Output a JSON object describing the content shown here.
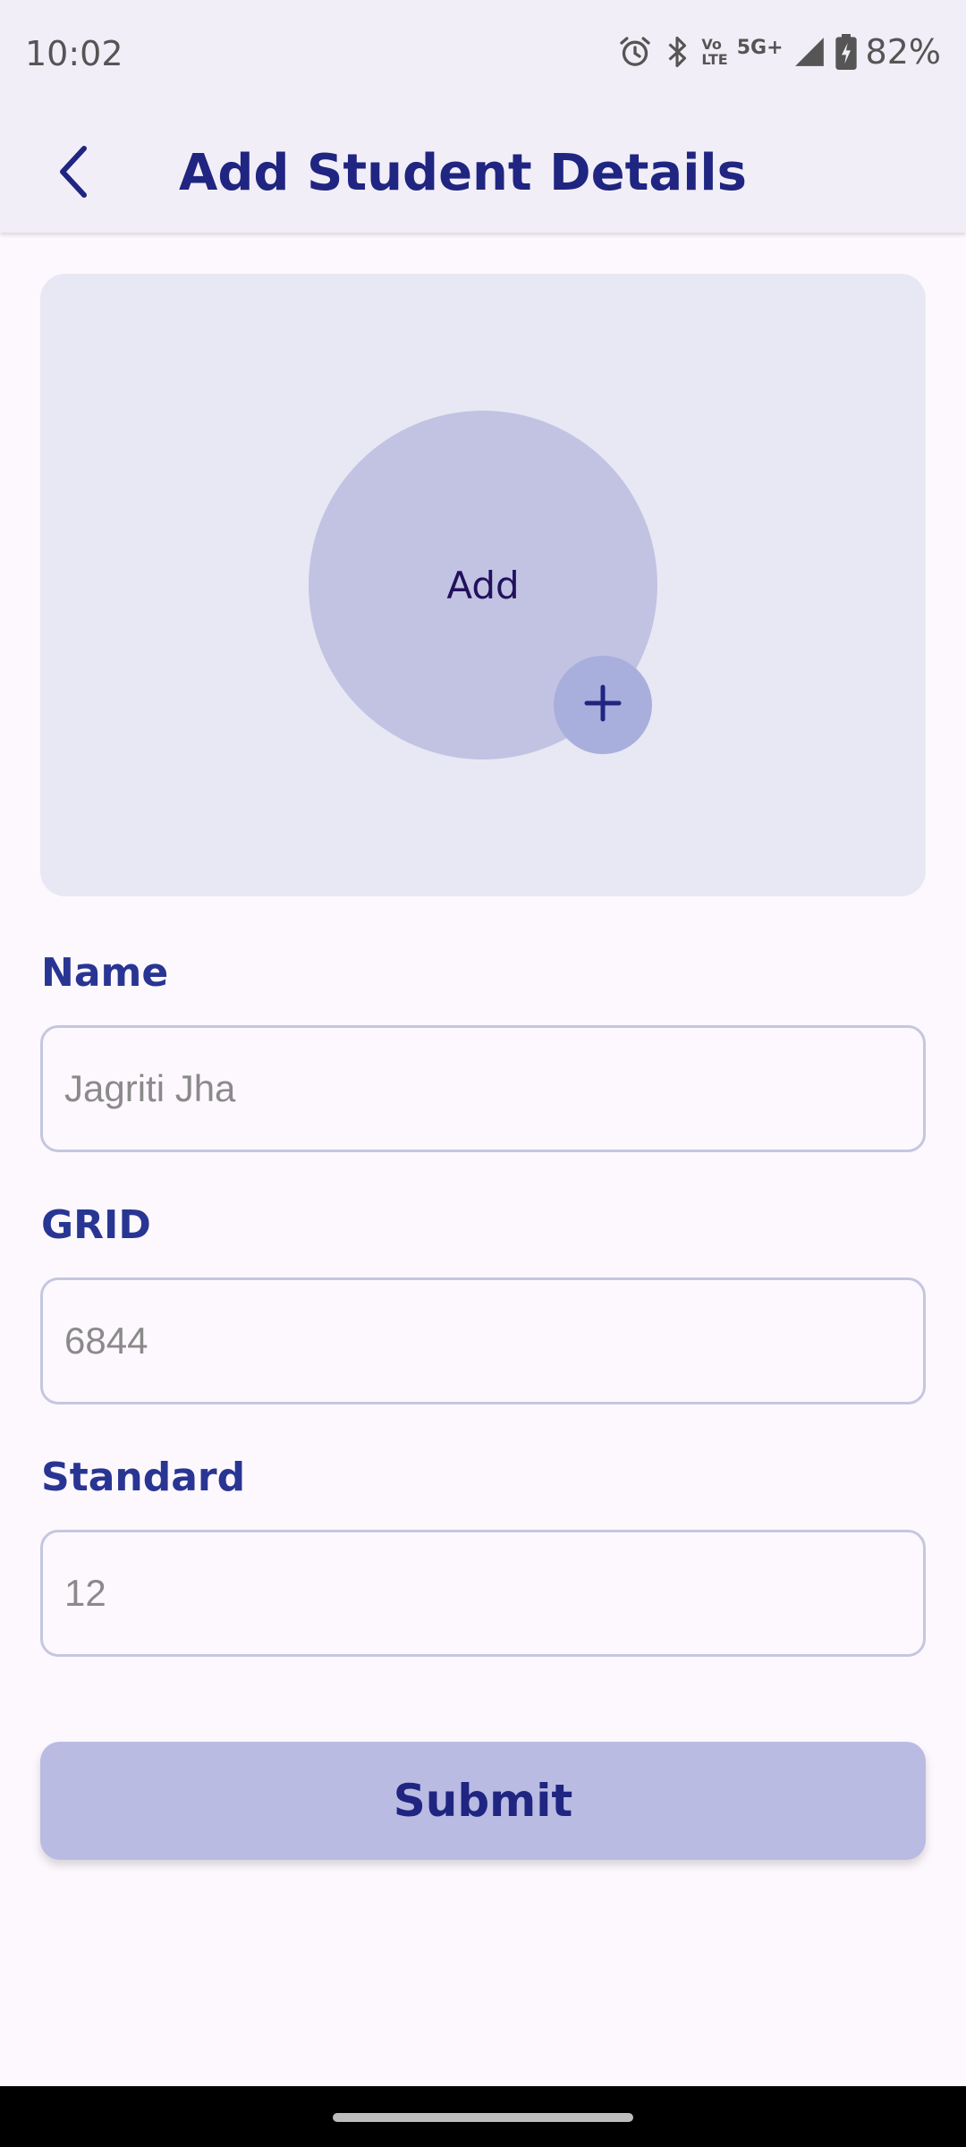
{
  "status_bar": {
    "time": "10:02",
    "volte_top": "Vo",
    "volte_bottom": "LTE",
    "network": "5G+",
    "battery": "82%",
    "icons": [
      "alarm-icon",
      "bluetooth-icon",
      "volte-icon",
      "signal-icon",
      "battery-charging-icon"
    ]
  },
  "app_bar": {
    "title": "Add Student Details",
    "back_icon": "chevron-left-icon"
  },
  "photo": {
    "label": "Add",
    "add_icon": "plus-icon"
  },
  "form": {
    "name": {
      "label": "Name",
      "placeholder": "Jagriti Jha",
      "value": ""
    },
    "grid": {
      "label": "GRID",
      "placeholder": "6844",
      "value": ""
    },
    "standard": {
      "label": "Standard",
      "placeholder": "12",
      "value": ""
    }
  },
  "submit_label": "Submit",
  "colors": {
    "primary": "#1f2580",
    "label": "#283593",
    "card_bg": "#e7e8f4",
    "avatar_bg": "#c2c3e2",
    "button_bg": "#b9bbe2",
    "app_bar_bg": "#f2eef8",
    "page_bg": "#fdf8fd"
  }
}
